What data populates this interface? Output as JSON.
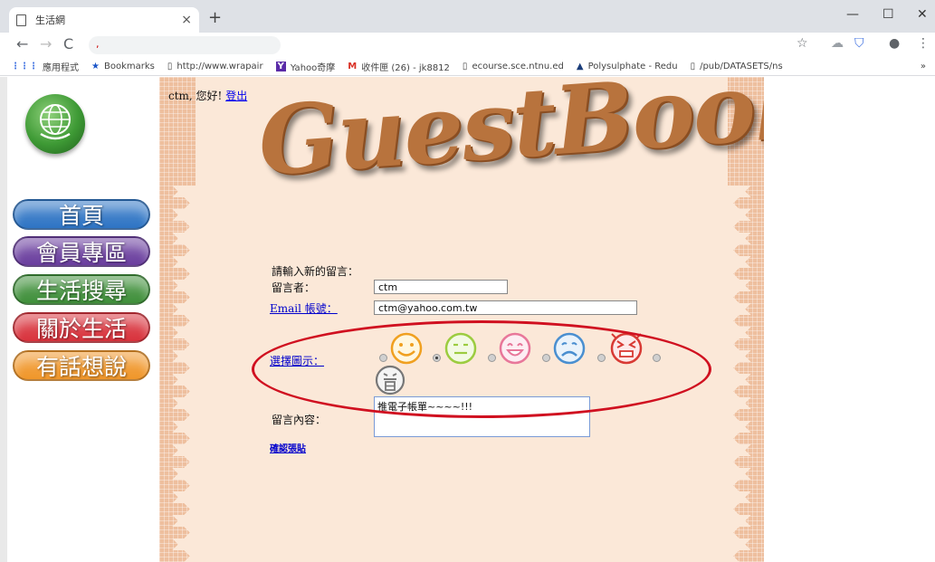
{
  "browser": {
    "tab_title": "生活網",
    "tab_close": "×",
    "new_tab": "+",
    "window_controls": [
      "—",
      "☐",
      "✕"
    ],
    "url": ","
  },
  "bookmarks": [
    {
      "icon": "apps-icon",
      "label": "應用程式"
    },
    {
      "icon": "star-icon",
      "label": "Bookmarks"
    },
    {
      "icon": "page-icon",
      "label": "http://www.wrapair"
    },
    {
      "icon": "yahoo-icon",
      "label": "Yahoo奇摩"
    },
    {
      "icon": "gmail-icon",
      "label": "收件匣 (26) - jk8812"
    },
    {
      "icon": "page-icon",
      "label": "ecourse.sce.ntnu.ed"
    },
    {
      "icon": "triangle-icon",
      "label": "Polysulphate - Redu"
    },
    {
      "icon": "page-icon",
      "label": "/pub/DATASETS/ns"
    }
  ],
  "nav": {
    "items": [
      {
        "label": "首頁",
        "color": "#2e74c4"
      },
      {
        "label": "會員專區",
        "color": "#6a3e9e"
      },
      {
        "label": "生活搜尋",
        "color": "#3f8f3a"
      },
      {
        "label": "關於生活",
        "color": "#d8323c"
      },
      {
        "label": "有話想說",
        "color": "#f0962a"
      }
    ]
  },
  "page": {
    "greeting": "ctm, 您好!",
    "logout": "登出",
    "banner": "GuestBook"
  },
  "form": {
    "prompt": "請輸入新的留言：",
    "author_label": "留言者：",
    "author_value": "ctm",
    "email_label": "Email 帳號：",
    "email_value": "ctm@yahoo.com.tw",
    "icon_label": "選擇圖示：",
    "emoticons": [
      {
        "name": "happy",
        "color": "#f0a020"
      },
      {
        "name": "content",
        "color": "#9ccc40"
      },
      {
        "name": "grin",
        "color": "#e8779a"
      },
      {
        "name": "sad",
        "color": "#4a8fd0"
      },
      {
        "name": "angry",
        "color": "#d83a34"
      },
      {
        "name": "mute",
        "color": "#777777"
      }
    ],
    "selected_icon": "happy",
    "content_label": "留言內容：",
    "content_value": "推電子帳單~~~~!!!",
    "submit": "確認張貼"
  }
}
